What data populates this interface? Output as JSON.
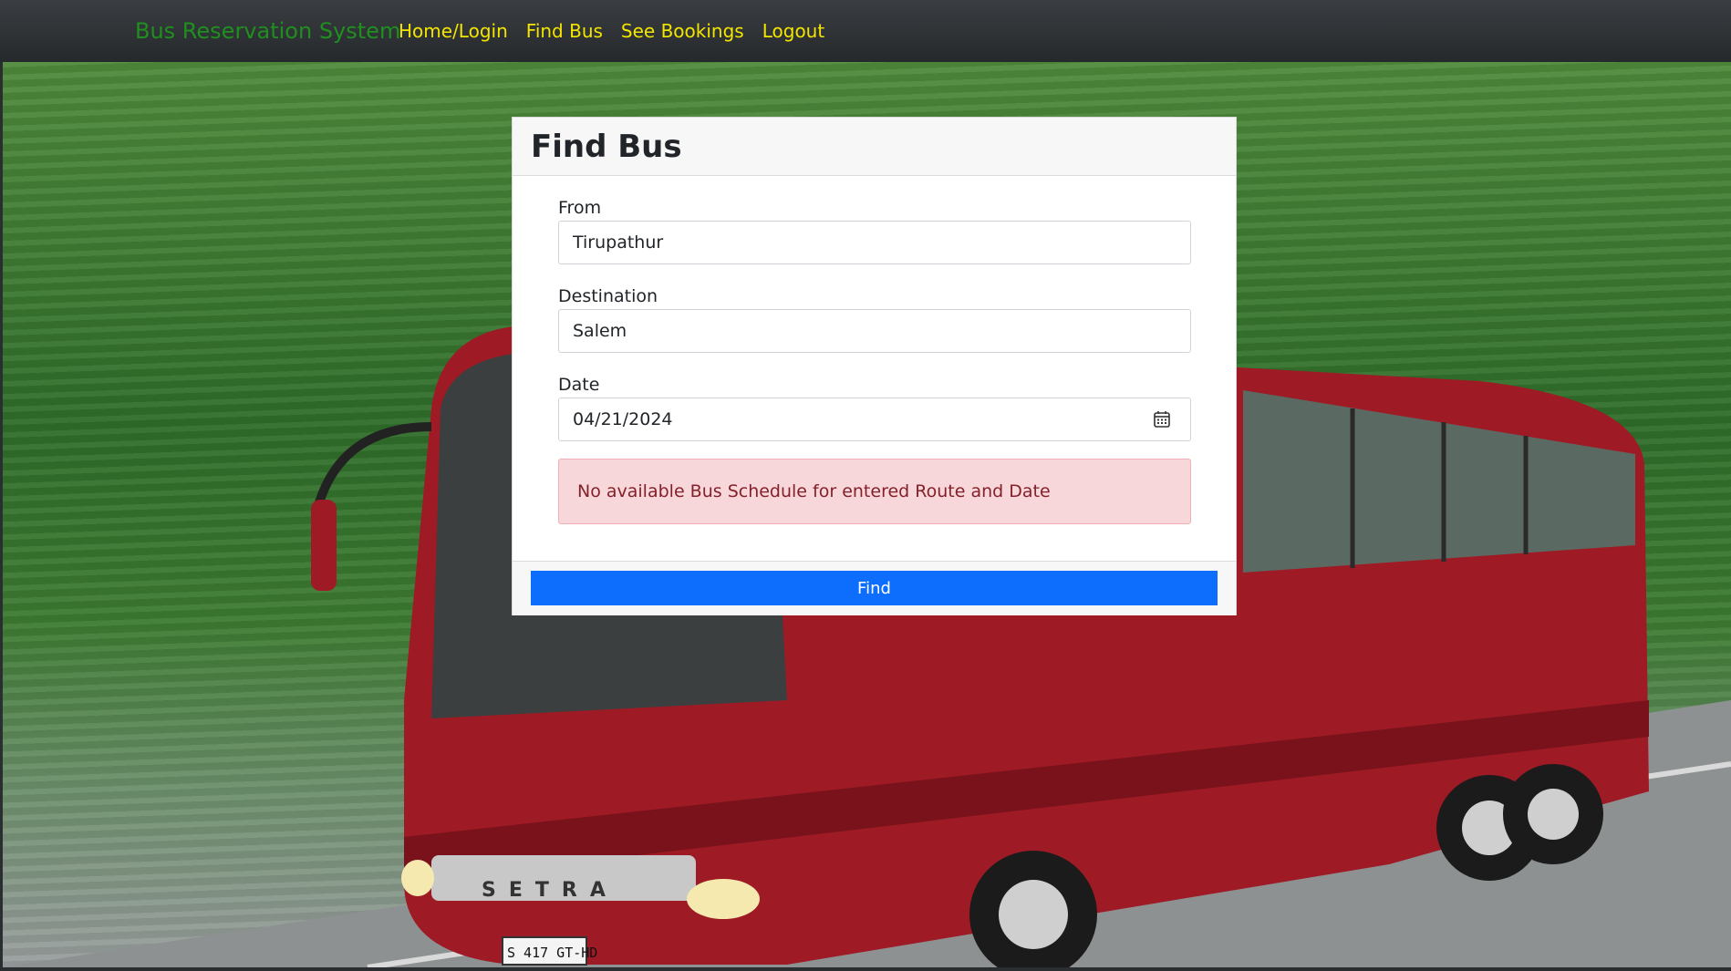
{
  "navbar": {
    "brand": "Bus Reservation System",
    "links": [
      "Home/Login",
      "Find Bus",
      "See Bookings",
      "Logout"
    ]
  },
  "card": {
    "title": "Find Bus",
    "from": {
      "label": "From",
      "value": "Tirupathur"
    },
    "destination": {
      "label": "Destination",
      "value": "Salem"
    },
    "date": {
      "label": "Date",
      "value": "04/21/2024"
    },
    "alert": "No available Bus Schedule for entered Route and Date",
    "find_label": "Find"
  },
  "background": {
    "bus_brand": "SETRA",
    "plate": "S 417 GT-HD"
  },
  "colors": {
    "brand": "#1f8f1f",
    "nav_link": "#f2e600",
    "primary": "#0d6efd",
    "alert_bg": "#f8d7da",
    "alert_text": "#842029",
    "bus_red": "#9e1b25"
  }
}
